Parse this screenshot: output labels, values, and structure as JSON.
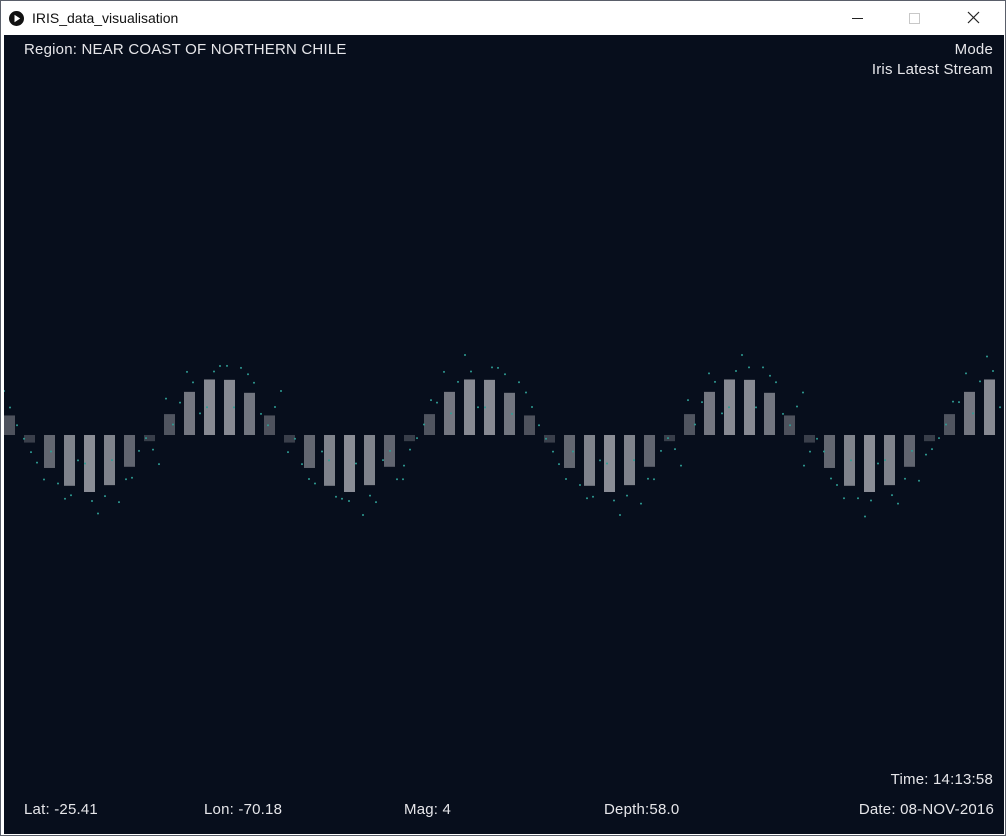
{
  "window": {
    "title": "IRIS_data_visualisation",
    "icon": "play-circle-icon",
    "controls": [
      "minimize-icon",
      "maximize-icon",
      "close-icon"
    ]
  },
  "overlay": {
    "region_label": "Region:",
    "region_value": "NEAR COAST OF NORTHERN CHILE",
    "mode_label": "Mode",
    "mode_value": "Iris Latest Stream",
    "time_label": "Time:",
    "time_value": "14:13:58",
    "lat_label": "Lat:",
    "lat_value": "-25.41",
    "lon_label": "Lon:",
    "lon_value": "-70.18",
    "mag_label": "Mag:",
    "mag_value": "4",
    "depth_label": "Depth:",
    "depth_value": "58.0",
    "date_label": "Date:",
    "date_value": "08-NOV-2016"
  },
  "visualisation": {
    "background_color": "#070e1c",
    "bar_color": "#8a8d96",
    "dot_color": "#2f9c94",
    "bar_count": 50,
    "wave_period_bars": 13,
    "amplitude": 1.0,
    "dot_pattern": "wave-particles"
  }
}
